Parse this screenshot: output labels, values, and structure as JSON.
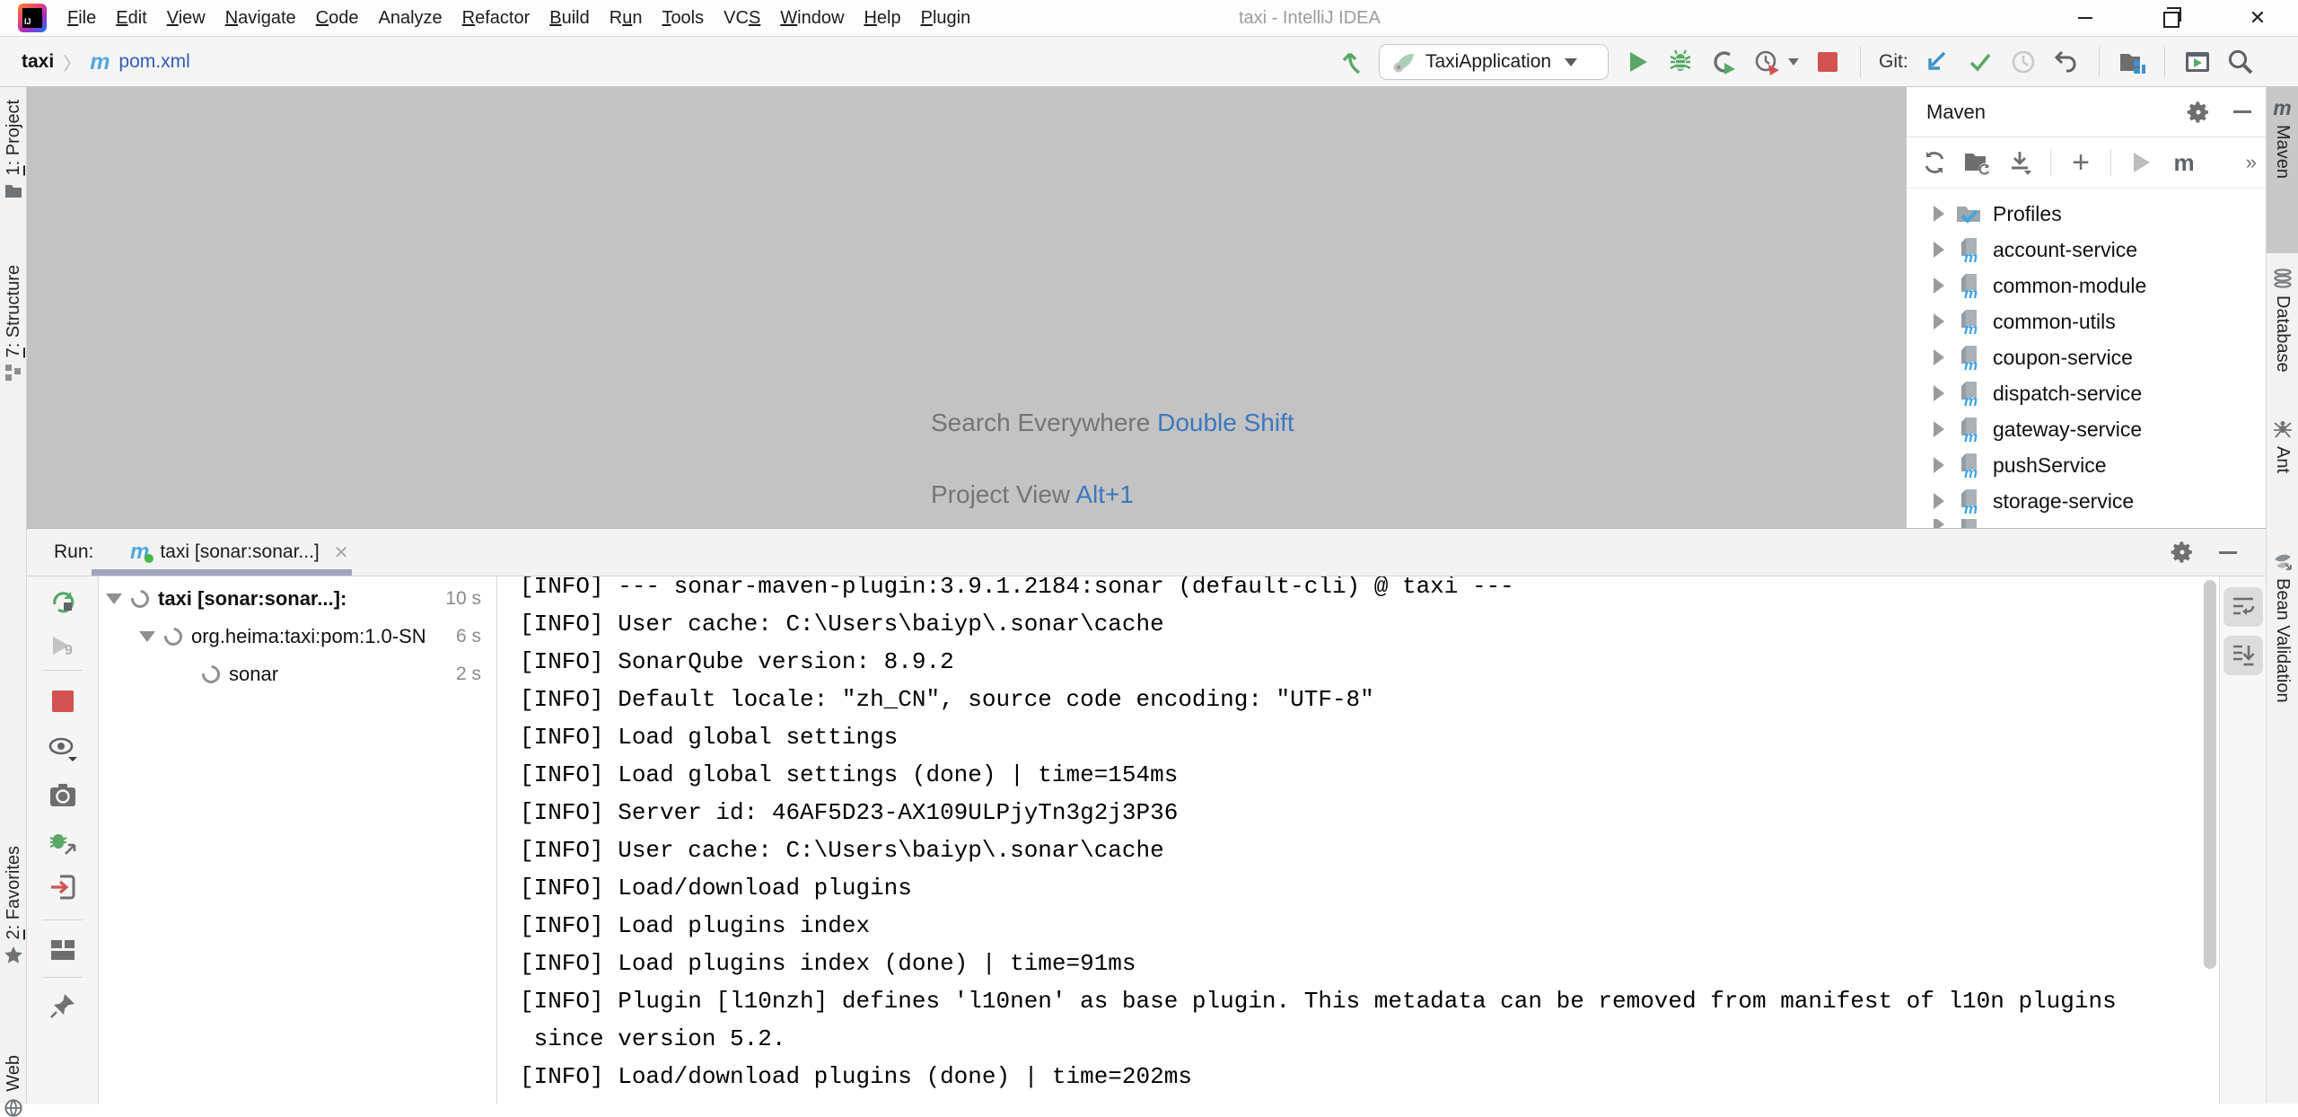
{
  "window": {
    "title": "taxi - IntelliJ IDEA",
    "minimize": "minimize",
    "restore": "restore",
    "close": "✕"
  },
  "menu": {
    "items": [
      {
        "label": "File",
        "m": 0
      },
      {
        "label": "Edit",
        "m": 0
      },
      {
        "label": "View",
        "m": 0
      },
      {
        "label": "Navigate",
        "m": 0
      },
      {
        "label": "Code",
        "m": 0
      },
      {
        "label": "Analyze",
        "m": -1
      },
      {
        "label": "Refactor",
        "m": 0
      },
      {
        "label": "Build",
        "m": 0
      },
      {
        "label": "Run",
        "m": 1
      },
      {
        "label": "Tools",
        "m": 0
      },
      {
        "label": "VCS",
        "m": 2
      },
      {
        "label": "Window",
        "m": 0
      },
      {
        "label": "Help",
        "m": 0
      },
      {
        "label": "Plugin",
        "m": 0
      }
    ]
  },
  "breadcrumb": {
    "project": "taxi",
    "chevron": "〉",
    "maven_icon": "m",
    "file": "pom.xml"
  },
  "toolbar": {
    "run_config": "TaxiApplication",
    "git_label": "Git:"
  },
  "editor": {
    "hints": [
      {
        "text": "Search Everywhere ",
        "shortcut": "Double Shift"
      },
      {
        "text": "Project View ",
        "shortcut": "Alt+1"
      }
    ]
  },
  "left_stripe": {
    "project": "1: Project",
    "structure": "7: Structure",
    "favorites": "2: Favorites",
    "web": "Web"
  },
  "right_stripe": {
    "maven_m": "m",
    "maven": "Maven",
    "database": "Database",
    "ant": "Ant",
    "bean_validation": "Bean Validation"
  },
  "maven_panel": {
    "title": "Maven",
    "profiles": "Profiles",
    "modules": [
      "account-service",
      "common-module",
      "common-utils",
      "coupon-service",
      "dispatch-service",
      "gateway-service",
      "pushService",
      "storage-service"
    ],
    "m_goal": "m",
    "more": "»"
  },
  "run_panel": {
    "label": "Run:",
    "tab_m": "m",
    "tab": "taxi [sonar:sonar...]",
    "tab_close": "✕",
    "tree": {
      "root": {
        "name": "taxi [sonar:sonar...]:",
        "time": "10 s"
      },
      "child": {
        "name": "org.heima:taxi:pom:1.0-SN",
        "time": "6 s"
      },
      "leaf": {
        "name": "sonar",
        "time": "2 s"
      }
    }
  },
  "console": {
    "lines": [
      "[INFO] --- sonar-maven-plugin:3.9.1.2184:sonar (default-cli) @ taxi ---",
      "[INFO] User cache: C:\\Users\\baiyp\\.sonar\\cache",
      "[INFO] SonarQube version: 8.9.2",
      "[INFO] Default locale: \"zh_CN\", source code encoding: \"UTF-8\"",
      "[INFO] Load global settings",
      "[INFO] Load global settings (done) | time=154ms",
      "[INFO] Server id: 46AF5D23-AX109ULPjyTn3g2j3P36",
      "[INFO] User cache: C:\\Users\\baiyp\\.sonar\\cache",
      "[INFO] Load/download plugins",
      "[INFO] Load plugins index",
      "[INFO] Load plugins index (done) | time=91ms",
      "[INFO] Plugin [l10nzh] defines 'l10nen' as base plugin. This metadata can be removed from manifest of l10n plugins",
      " since version 5.2.",
      "[INFO] Load/download plugins (done) | time=202ms"
    ]
  },
  "colors": {
    "accent_blue": "#3c78be",
    "maven_blue": "#52a7e0",
    "run_green": "#59a869",
    "stop_red": "#d25252",
    "link_blue": "#2f5bb7",
    "editor_bg": "#c3c3c3"
  }
}
